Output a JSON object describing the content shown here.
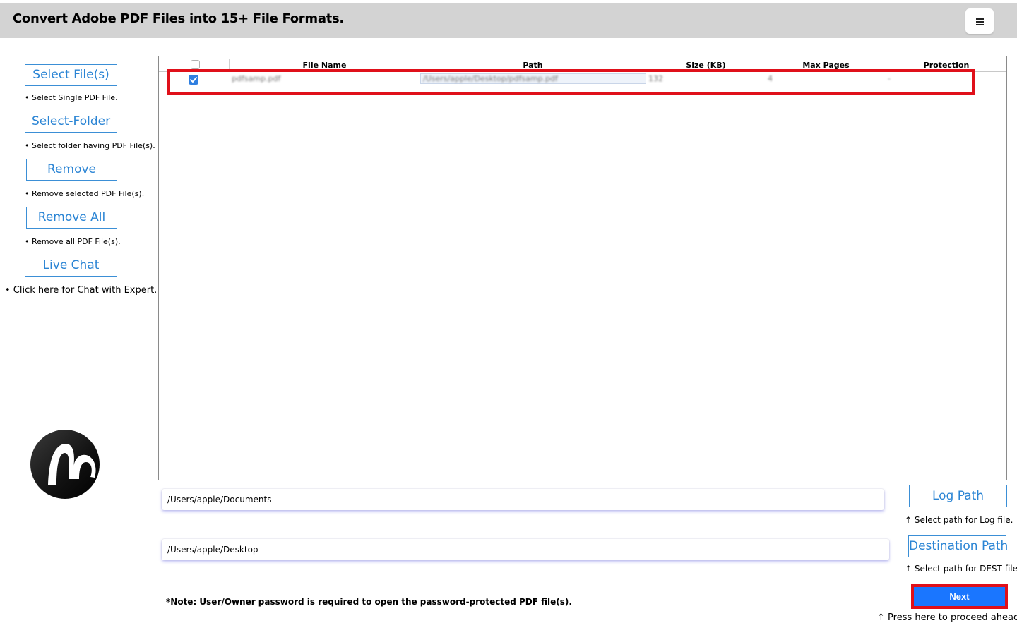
{
  "header": {
    "title": "Convert Adobe PDF Files into 15+ File Formats."
  },
  "sidebar": {
    "buttons": [
      {
        "label": "Select File(s)",
        "hint": "• Select Single PDF File."
      },
      {
        "label": "Select-Folder",
        "hint": "• Select folder having PDF File(s)."
      },
      {
        "label": "Remove",
        "hint": "• Remove selected PDF File(s)."
      },
      {
        "label": "Remove All",
        "hint": "• Remove all PDF File(s)."
      },
      {
        "label": "Live Chat",
        "hint": "• Click here for Chat with Expert."
      }
    ]
  },
  "table": {
    "columns": [
      "File Name",
      "Path",
      "Size (KB)",
      "Max Pages",
      "Protection"
    ],
    "rows": [
      {
        "checked": true,
        "file_name": "pdfsamp.pdf",
        "path": "/Users/apple/Desktop/pdfsamp.pdf",
        "size": "132",
        "max_pages": "4",
        "protection": "-"
      }
    ]
  },
  "log": {
    "path": "/Users/apple/Documents",
    "button": "Log Path",
    "hint": "↑ Select path for Log file."
  },
  "destination": {
    "path": "/Users/apple/Desktop",
    "button": "Destination Path",
    "hint": "↑ Select path for DEST file."
  },
  "note": "*Note: User/Owner password is required to open the password-protected PDF file(s).",
  "next": {
    "label": "Next",
    "hint": "↑ Press here to proceed ahead."
  },
  "colors": {
    "accent": "#2a84d4",
    "next_button": "#1a76ff",
    "highlight": "#e0101a",
    "header_bg": "#d3d3d3"
  },
  "icons": {
    "menu": "hamburger-menu-icon",
    "logo": "brand-logo"
  }
}
